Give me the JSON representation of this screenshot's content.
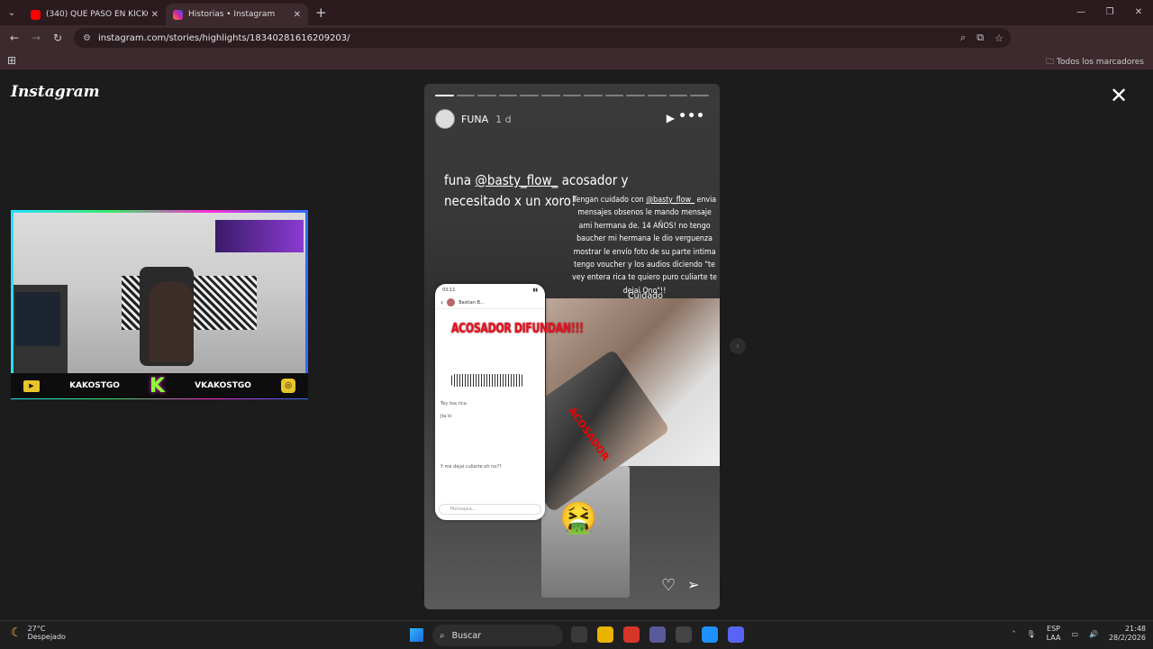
{
  "browser": {
    "tabs": [
      {
        "title": "(340) QUÉ PASÓ EN KICKCHILE",
        "favicon_color": "#ff0000",
        "active": false
      },
      {
        "title": "Historias • Instagram",
        "favicon_color": "#d6249f",
        "active": true
      }
    ],
    "new_tab_symbol": "+",
    "url": "instagram.com/stories/highlights/18340281616209203/",
    "bookmarks_label": "Todos los marcadores",
    "window_controls": [
      "—",
      "❐",
      "✕"
    ]
  },
  "instagram": {
    "logo": "Instagram",
    "story": {
      "username": "FUNA",
      "time": "1 d",
      "progress_total": 13,
      "progress_done": 1,
      "headline_prefix": "funa ",
      "headline_mention": "@basty_flow_",
      "headline_suffix": " acosador y necesitado x un xoro!",
      "warn_prefix": "Tengan cuidado con ",
      "warn_mention": "@basty_flow_",
      "warn_body": " envia mensajes obsenos le mando mensaje ami hermana de. 14 AÑOS! no tengo baucher mi hermana le dio verguenza mostrar le envío foto de su parte intima tengo voucher y los audios diciendo \"te vey entera rica te quiero puro culiarte te dejai Ono\"!!",
      "cuidado": "Cuidado",
      "sticker_text": "ACOSADOR DIFUNDAN!!!",
      "rotated_label": "ACOSADOR",
      "emoji": "🤮",
      "chat": {
        "time": "03:11",
        "contact": "Bastian B...",
        "lines": [
          "Tey toa rica",
          "Jta ki",
          "Y me dejai culiarte oh no??"
        ],
        "input_placeholder": "Mensajea..."
      }
    }
  },
  "webcam": {
    "left_name": "KAKOSTGO",
    "right_name": "VKAKOSTGO",
    "center_logo": "K"
  },
  "taskbar": {
    "temperature": "27°C",
    "weather": "Despejado",
    "search_label": "Buscar",
    "lang_top": "ESP",
    "lang_bottom": "LAA",
    "time": "21:48",
    "date": "28/2/2026",
    "app_colors": [
      "#3a3a3a",
      "#e8b400",
      "#d8352a",
      "#5a5a9a",
      "#444444",
      "#1e90ff",
      "#5865f2"
    ]
  }
}
